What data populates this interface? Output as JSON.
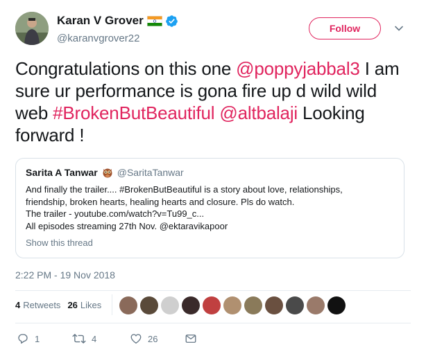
{
  "author": {
    "display_name": "Karan V Grover",
    "handle": "@karanvgrover22",
    "flag_icon": "india-flag-icon",
    "verified_icon": "verified-badge-icon",
    "verified_color": "#1da1f2"
  },
  "follow_label": "Follow",
  "accent_color": "#e0245e",
  "tweet": {
    "part1": "Congratulations on this one ",
    "mention1": "@poppyjabbal3",
    "part2": " I am sure ur performance is gona fire up d wild wild web ",
    "hashtag": "#BrokenButBeautiful",
    "part3": " ",
    "mention2": "@altbalaji",
    "part4": " Looking forward !"
  },
  "quote": {
    "name": "Sarita A Tanwar",
    "emoji_icon": "owl-emoji-icon",
    "handle": "@SaritaTanwar",
    "lines": [
      "And finally the trailer.... #BrokenButBeautiful is a story about love, relationships,",
      "friendship, broken hearts, healing hearts and closure. Pls do watch.",
      "The trailer - youtube.com/watch?v=Tu99_c...",
      "All episodes streaming 27th Nov. @ektaravikapoor"
    ],
    "show_thread": "Show this thread"
  },
  "timestamp": "2:22 PM - 19 Nov 2018",
  "stats": {
    "retweets_count": "4",
    "retweets_label": "Retweets",
    "likes_count": "26",
    "likes_label": "Likes"
  },
  "likers": [
    {
      "icon": "avatar-1",
      "color": "#8a6a5a"
    },
    {
      "icon": "avatar-2",
      "color": "#5a4a3a"
    },
    {
      "icon": "avatar-3",
      "color": "#cfcfcf"
    },
    {
      "icon": "avatar-4",
      "color": "#3a2a2a"
    },
    {
      "icon": "avatar-5",
      "color": "#c04040"
    },
    {
      "icon": "avatar-6",
      "color": "#b09070"
    },
    {
      "icon": "avatar-7",
      "color": "#8a7a5a"
    },
    {
      "icon": "avatar-8",
      "color": "#6a5040"
    },
    {
      "icon": "avatar-9",
      "color": "#4a4a4a"
    },
    {
      "icon": "avatar-10",
      "color": "#9a7a6a"
    },
    {
      "icon": "altbalaji-avatar",
      "color": "#111111"
    }
  ],
  "actions": {
    "reply_count": "1",
    "retweet_count": "4",
    "like_count": "26",
    "reply_icon": "reply-icon",
    "retweet_icon": "retweet-icon",
    "like_icon": "heart-icon",
    "dm_icon": "envelope-icon"
  }
}
